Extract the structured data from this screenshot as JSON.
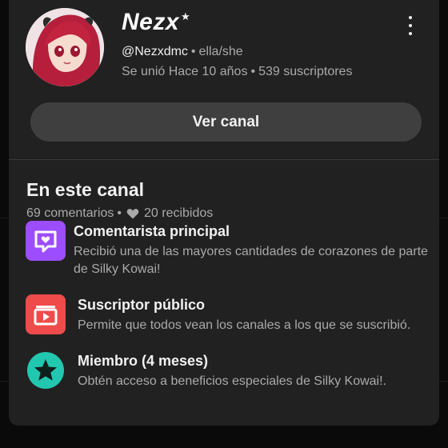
{
  "channel": {
    "name": "Nezx",
    "handle": "@Nezxdmc",
    "pronouns": "ella/she",
    "joined": "Se unió Hace 10 años",
    "subscribers": "539 suscriptores",
    "view_button_label": "Ver canal"
  },
  "section": {
    "title": "En este canal",
    "comments": "69 comentarios",
    "hearts": "20 recibidos"
  },
  "badges": [
    {
      "title": "Comentarista principal",
      "description": "Recibió una de las mayores cantidades de corazones de parte de Silky Kowai!",
      "icon": "comment-heart-icon",
      "color": "#9c4dff"
    },
    {
      "title": "Suscriptor público",
      "description": "Permite que todos vean los canales a los que se suscribió.",
      "icon": "subscriptions-icon",
      "color": "#ef4b4b"
    },
    {
      "title": "Miembro (4 meses)",
      "description": "Obtén acceso a beneficios especiales de Silky Kowai!.",
      "icon": "member-star-icon",
      "color": "#22c7b0"
    }
  ],
  "colors": {
    "sheet_bg": "#212121",
    "button_bg": "#3f3f3f",
    "secondary_text": "#aaaaaa"
  }
}
